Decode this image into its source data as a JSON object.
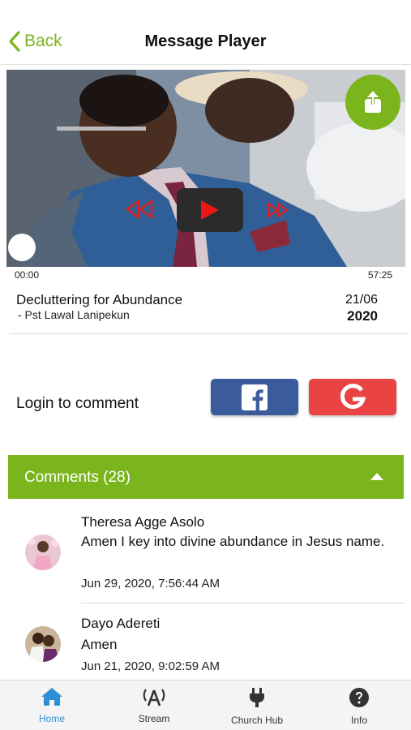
{
  "header": {
    "back_label": "Back",
    "title": "Message Player"
  },
  "player": {
    "elapsed": "00:00",
    "duration": "57:25"
  },
  "message": {
    "title": "Decluttering for Abundance",
    "author": "- Pst Lawal Lanipekun",
    "day_month": "21/06",
    "year": "2020"
  },
  "login": {
    "prompt": "Login to comment"
  },
  "comments": {
    "header": "Comments (28)",
    "items": [
      {
        "name": "Theresa Agge Asolo",
        "text": "Amen I key into divine abundance in Jesus name.",
        "date": "Jun 29, 2020, 7:56:44 AM"
      },
      {
        "name": "Dayo Adereti",
        "text": "Amen",
        "date": "Jun 21, 2020, 9:02:59 AM"
      }
    ]
  },
  "tabbar": {
    "items": [
      {
        "label": "Home",
        "icon": "home-icon",
        "active": true
      },
      {
        "label": "Stream",
        "icon": "antenna-icon",
        "active": false
      },
      {
        "label": "Church Hub",
        "icon": "plug-icon",
        "active": false
      },
      {
        "label": "Info",
        "icon": "help-icon",
        "active": false
      }
    ]
  },
  "colors": {
    "accent_green": "#7ab51d",
    "facebook_blue": "#3b5c9c",
    "google_red": "#e94343",
    "active_tab_blue": "#2e8fd6",
    "control_red": "#e02020"
  }
}
